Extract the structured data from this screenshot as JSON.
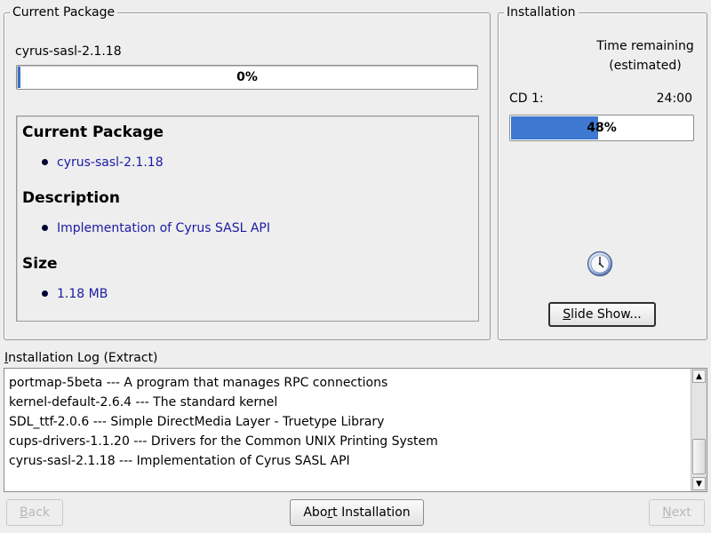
{
  "current_package": {
    "frame_title": "Current Package",
    "name": "cyrus-sasl-2.1.18",
    "progress_percent": 0,
    "progress_text": "0%",
    "details": [
      {
        "heading": "Current Package",
        "value": "cyrus-sasl-2.1.18"
      },
      {
        "heading": "Description",
        "value": "Implementation of Cyrus SASL API"
      },
      {
        "heading": "Size",
        "value": "1.18 MB"
      }
    ]
  },
  "installation": {
    "frame_title": "Installation",
    "time_remaining_line1": "Time remaining",
    "time_remaining_line2": "(estimated)",
    "cd_label": "CD 1:",
    "cd_time": "24:00",
    "cd_progress_percent": 48,
    "cd_progress_text": "48%",
    "slideshow_label_prefix": "S",
    "slideshow_label_rest": "lide Show..."
  },
  "log": {
    "label_prefix": "I",
    "label_rest": "nstallation Log (Extract)",
    "lines": [
      "portmap-5beta --- A program that manages RPC connections",
      "kernel-default-2.6.4 --- The standard kernel",
      "SDL_ttf-2.0.6 --- Simple DirectMedia Layer - Truetype Library",
      "cups-drivers-1.1.20 --- Drivers for the Common UNIX Printing System",
      "cyrus-sasl-2.1.18 --- Implementation of Cyrus SASL API"
    ]
  },
  "buttons": {
    "back_prefix": "B",
    "back_rest": "ack",
    "abort_before": "Abo",
    "abort_key": "r",
    "abort_after": "t Installation",
    "next_prefix": "N",
    "next_rest": "ext"
  },
  "colors": {
    "progress_fill": "#3e78d0",
    "link_text": "#1a1aa6"
  }
}
